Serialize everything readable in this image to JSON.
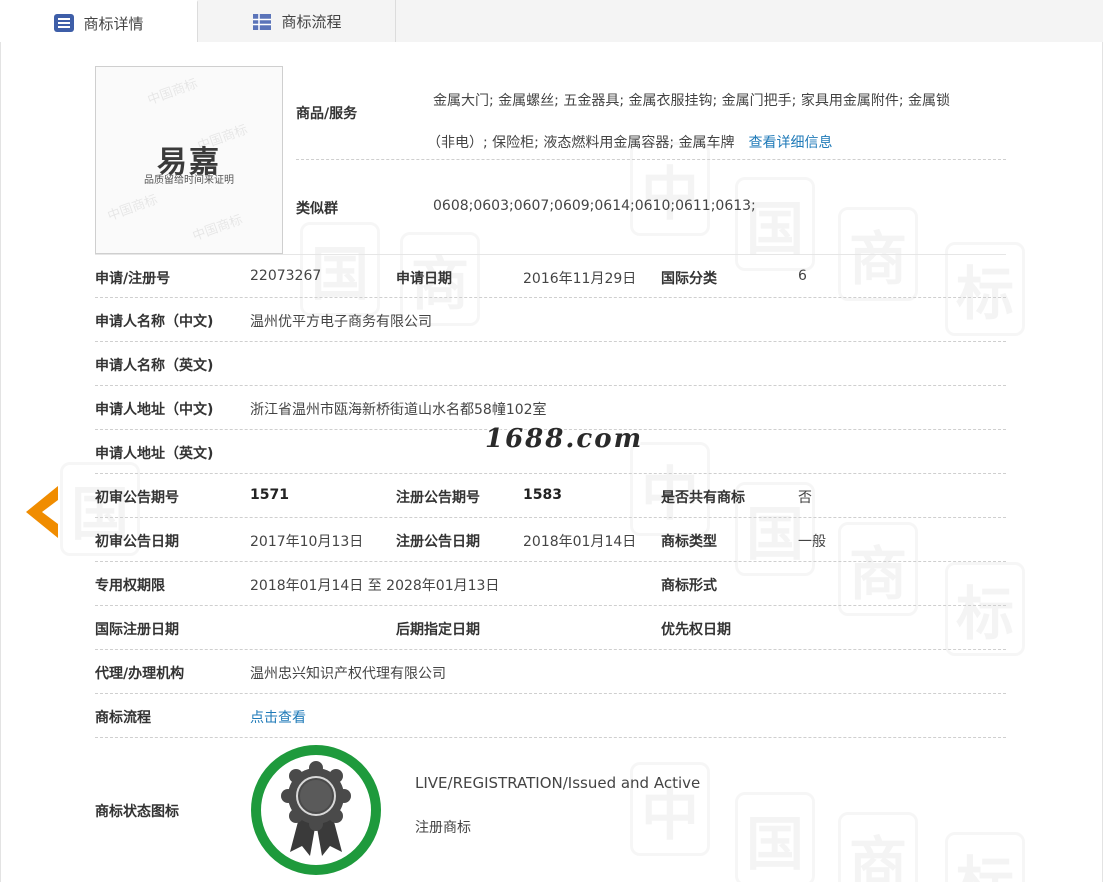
{
  "tabs": [
    {
      "label": "商标详情",
      "icon": "list-icon",
      "active": true
    },
    {
      "label": "商标流程",
      "icon": "grid-icon",
      "active": false
    }
  ],
  "logo": {
    "main": "易嘉",
    "sub": "品质留给时间来证明"
  },
  "watermark": {
    "site": "1688.com"
  },
  "goods": {
    "label": "商品/服务",
    "line1": "金属大门; 金属螺丝; 五金器具; 金属衣服挂钩; 金属门把手; 家具用金属附件; 金属锁",
    "line2": "（非电）; 保险柜; 液态燃料用金属容器; 金属车牌",
    "more_link": "查看详细信息"
  },
  "similar": {
    "label": "类似群",
    "value": "0608;0603;0607;0609;0614;0610;0611;0613;"
  },
  "rows": {
    "reg_no_label": "申请/注册号",
    "reg_no": "22073267",
    "apply_date_label": "申请日期",
    "apply_date": "2016年11月29日",
    "intl_class_label": "国际分类",
    "intl_class": "6",
    "applicant_cn_label": "申请人名称（中文)",
    "applicant_cn": "温州优平方电子商务有限公司",
    "applicant_en_label": "申请人名称（英文)",
    "applicant_en": "",
    "address_cn_label": "申请人地址（中文)",
    "address_cn": "浙江省温州市瓯海新桥街道山水名都58幢102室",
    "address_en_label": "申请人地址（英文)",
    "address_en": "",
    "prelim_issue_label": "初审公告期号",
    "prelim_issue": "1571",
    "reg_issue_label": "注册公告期号",
    "reg_issue": "1583",
    "shared_label": "是否共有商标",
    "shared": "否",
    "prelim_date_label": "初审公告日期",
    "prelim_date": "2017年10月13日",
    "reg_date_label": "注册公告日期",
    "reg_date": "2018年01月14日",
    "tm_type_label": "商标类型",
    "tm_type": "一般",
    "exclusive_label": "专用权期限",
    "exclusive": "2018年01月14日 至 2028年01月13日",
    "tm_form_label": "商标形式",
    "tm_form": "",
    "intl_reg_date_label": "国际注册日期",
    "intl_reg_date": "",
    "later_date_label": "后期指定日期",
    "later_date": "",
    "priority_date_label": "优先权日期",
    "priority_date": "",
    "agent_label": "代理/办理机构",
    "agent": "温州忠兴知识产权代理有限公司",
    "process_label": "商标流程",
    "process_link": "点击查看"
  },
  "status": {
    "label": "商标状态图标",
    "en": "LIVE/REGISTRATION/Issued and Active",
    "cn": "注册商标",
    "ring_color": "#1e9a3c"
  },
  "colors": {
    "link": "#1f7ab8",
    "arrow": "#f08c00",
    "tab_icon": "#3e5ea8"
  }
}
